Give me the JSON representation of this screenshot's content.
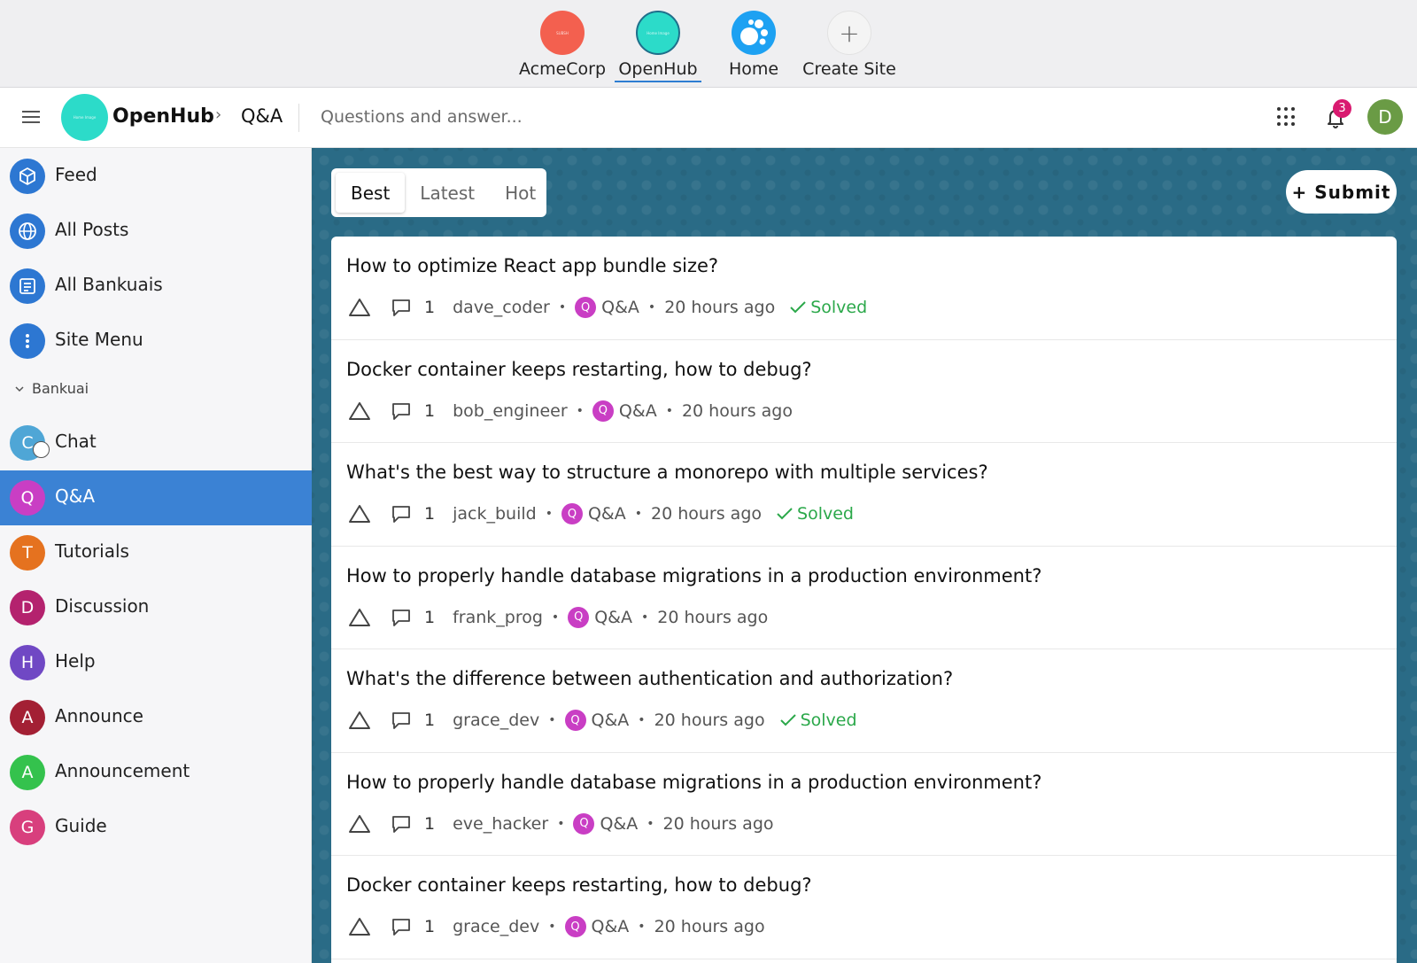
{
  "sites": [
    {
      "name": "AcmeCorp",
      "color": "#f3604f",
      "placeholder": "SUBSH"
    },
    {
      "name": "OpenHub",
      "color": "#2cdbc9",
      "placeholder": "Home Image"
    },
    {
      "name": "Home",
      "color": "#1da1f2"
    },
    {
      "name": "Create Site",
      "symbol": "+"
    }
  ],
  "header": {
    "brand": "OpenHub",
    "logo_placeholder": "Home Image",
    "breadcrumb_separator": "›",
    "breadcrumb": "Q&A",
    "description": "Questions and answer...",
    "notification_count": "3",
    "avatar_letter": "D"
  },
  "sidebar": {
    "items": [
      {
        "label": "Feed",
        "icon": "cube-icon",
        "color": "#2d77d2"
      },
      {
        "label": "All Posts",
        "icon": "globe-icon",
        "color": "#2d77d2"
      },
      {
        "label": "All Bankuais",
        "icon": "list-icon",
        "color": "#2d77d2"
      },
      {
        "label": "Site Menu",
        "icon": "more-vertical-icon",
        "color": "#2d77d2"
      }
    ],
    "section_label": "Bankuai",
    "communities": [
      {
        "letter": "C",
        "label": "Chat",
        "color": "#4fa6d6"
      },
      {
        "letter": "Q",
        "label": "Q&A",
        "color": "#c93ec4",
        "active": true
      },
      {
        "letter": "T",
        "label": "Tutorials",
        "color": "#e5721f"
      },
      {
        "letter": "D",
        "label": "Discussion",
        "color": "#b4226e"
      },
      {
        "letter": "H",
        "label": "Help",
        "color": "#7048c4"
      },
      {
        "letter": "A",
        "label": "Announce",
        "color": "#a32034"
      },
      {
        "letter": "A",
        "label": "Announcement",
        "color": "#34c24d"
      },
      {
        "letter": "G",
        "label": "Guide",
        "color": "#d83f7d"
      }
    ]
  },
  "tabs": [
    "Best",
    "Latest",
    "Hot"
  ],
  "active_tab": "Best",
  "submit_label": "+ Submit",
  "posts": [
    {
      "title": "How to optimize React app bundle size?",
      "comments": "1",
      "author": "dave_coder",
      "community_letter": "Q",
      "community": "Q&A",
      "time": "20 hours ago",
      "solved": "Solved"
    },
    {
      "title": "Docker container keeps restarting, how to debug?",
      "comments": "1",
      "author": "bob_engineer",
      "community_letter": "Q",
      "community": "Q&A",
      "time": "20 hours ago",
      "solved": ""
    },
    {
      "title": "What's the best way to structure a monorepo with multiple services?",
      "comments": "1",
      "author": "jack_build",
      "community_letter": "Q",
      "community": "Q&A",
      "time": "20 hours ago",
      "solved": "Solved"
    },
    {
      "title": "How to properly handle database migrations in a production environment?",
      "comments": "1",
      "author": "frank_prog",
      "community_letter": "Q",
      "community": "Q&A",
      "time": "20 hours ago",
      "solved": ""
    },
    {
      "title": "What's the difference between authentication and authorization?",
      "comments": "1",
      "author": "grace_dev",
      "community_letter": "Q",
      "community": "Q&A",
      "time": "20 hours ago",
      "solved": "Solved"
    },
    {
      "title": "How to properly handle database migrations in a production environment?",
      "comments": "1",
      "author": "eve_hacker",
      "community_letter": "Q",
      "community": "Q&A",
      "time": "20 hours ago",
      "solved": ""
    },
    {
      "title": "Docker container keeps restarting, how to debug?",
      "comments": "1",
      "author": "grace_dev",
      "community_letter": "Q",
      "community": "Q&A",
      "time": "20 hours ago",
      "solved": ""
    }
  ]
}
